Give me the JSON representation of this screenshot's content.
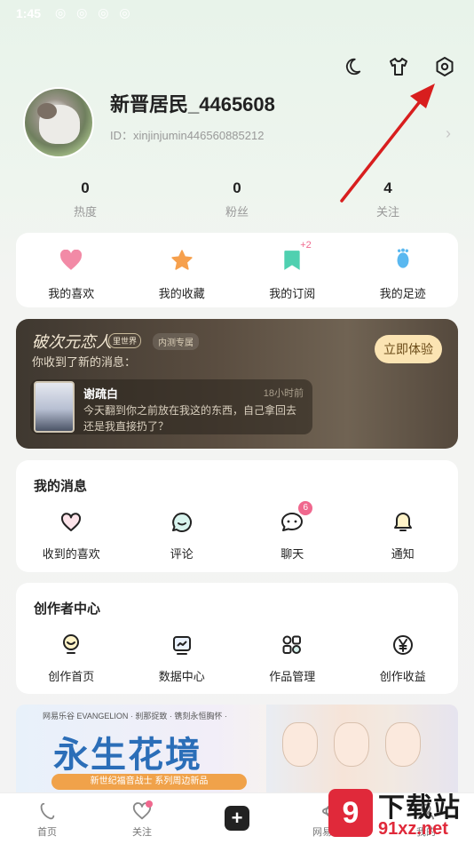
{
  "status_bar": {
    "time": "1:45",
    "icons": "◎ ◎ ◎ ◎"
  },
  "top_actions": [
    "moon-icon",
    "tshirt-icon",
    "settings-icon"
  ],
  "profile": {
    "username": "新晋居民_4465608",
    "id_text": "ID：xinjinjumin446560885212"
  },
  "stats": [
    {
      "value": "0",
      "label": "热度"
    },
    {
      "value": "0",
      "label": "粉丝"
    },
    {
      "value": "4",
      "label": "关注"
    }
  ],
  "quick": [
    {
      "label": "我的喜欢",
      "icon": "heart-icon",
      "color": "#f28aa6"
    },
    {
      "label": "我的收藏",
      "icon": "star-icon",
      "color": "#f6a04d"
    },
    {
      "label": "我的订阅",
      "icon": "bookmark-icon",
      "color": "#4fd0b0",
      "badge": "+2"
    },
    {
      "label": "我的足迹",
      "icon": "footprint-icon",
      "color": "#5ab8f0"
    }
  ],
  "promo": {
    "logo": "破次元恋人",
    "logo_sub": "里世界",
    "tag": "内测专属",
    "subtitle": "你收到了新的消息：",
    "button": "立即体验",
    "sender": "谢疏白",
    "time": "18小时前",
    "message": "今天翻到你之前放在我这的东西，自己拿回去还是我直接扔了？"
  },
  "messages": {
    "title": "我的消息",
    "items": [
      {
        "label": "收到的喜欢",
        "icon": "heart-outline-icon"
      },
      {
        "label": "评论",
        "icon": "comment-icon"
      },
      {
        "label": "聊天",
        "icon": "chat-icon",
        "badge": "6"
      },
      {
        "label": "通知",
        "icon": "bell-icon"
      }
    ]
  },
  "creator": {
    "title": "创作者中心",
    "items": [
      {
        "label": "创作首页",
        "icon": "creator-home-icon"
      },
      {
        "label": "数据中心",
        "icon": "data-chart-icon"
      },
      {
        "label": "作品管理",
        "icon": "works-grid-icon"
      },
      {
        "label": "创作收益",
        "icon": "yen-coin-icon"
      }
    ]
  },
  "banner": {
    "small_text": "网易乐谷   EVANGELION   · 刹那捉致 · 镌刻永恒胸怀 ·",
    "title": "永生花境",
    "strip": "新世纪福音战士 系列周边新品"
  },
  "bottom_nav": [
    {
      "label": "首页",
      "icon": "home-icon"
    },
    {
      "label": "关注",
      "icon": "follow-icon"
    },
    {
      "label": "",
      "icon": "plus-icon"
    },
    {
      "label": "网易乐谷",
      "icon": "planet-icon"
    },
    {
      "label": "我的",
      "icon": "profile-icon"
    }
  ],
  "watermark": {
    "logo": "9",
    "text": "下载站",
    "sub": "91xz.net"
  },
  "colors": {
    "accent_pink": "#f0688e",
    "promo_button": "#fbe4b3",
    "annotation_arrow": "#d81e1e"
  }
}
